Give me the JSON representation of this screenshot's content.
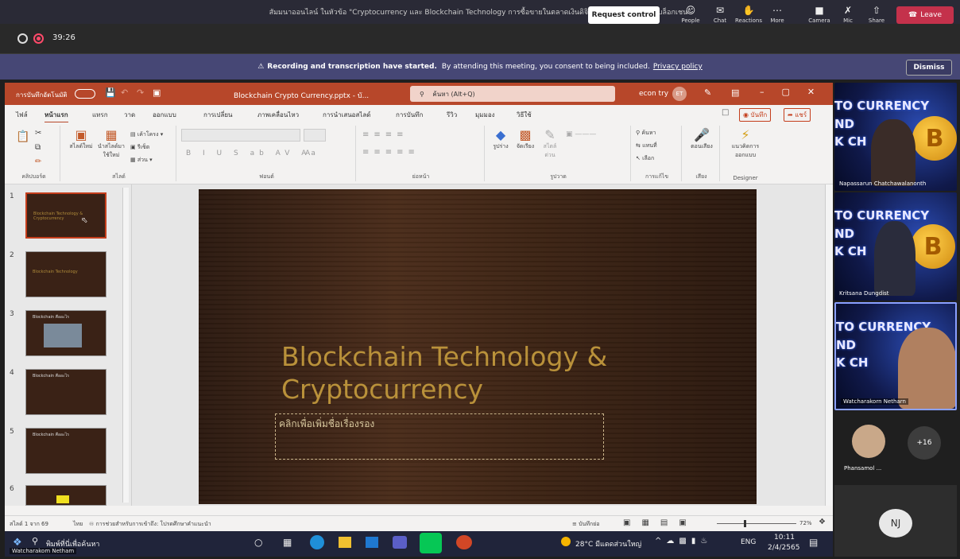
{
  "window_title": "สัมมนาออนไลน์ ในหัวข้อ \"Cryptocurrency และ Blockchain Technology การซื้อขายในตลาดเงินดิจิทัล และรู้จักเทคโนโลยีบล็อกเชน\"",
  "meeting": {
    "timer": "39:26",
    "request_control": "Request control",
    "buttons": [
      {
        "label": "People",
        "icon": "people-icon"
      },
      {
        "label": "Chat",
        "icon": "chat-icon"
      },
      {
        "label": "Reactions",
        "icon": "reactions-icon"
      },
      {
        "label": "More",
        "icon": "more-icon"
      },
      {
        "label": "Camera",
        "icon": "camera-off-icon"
      },
      {
        "label": "Mic",
        "icon": "mic-off-icon"
      },
      {
        "label": "Share",
        "icon": "share-icon"
      }
    ],
    "leave": "Leave"
  },
  "banner": {
    "bold": "Recording and transcription have started.",
    "text": "By attending this meeting, you consent to being included.",
    "link": "Privacy policy",
    "dismiss": "Dismiss"
  },
  "ppt": {
    "autosave": "การบันทึกอัตโนมัติ",
    "filename": "Blockchain Crypto Currency.pptx - บั...",
    "search": "ค้นหา (Alt+Q)",
    "user": "econ try",
    "user_initials": "ET",
    "tabs": [
      "ไฟล์",
      "หน้าแรก",
      "แทรก",
      "วาด",
      "ออกแบบ",
      "การเปลี่ยน",
      "ภาพเคลื่อนไหว",
      "การนำเสนอสไลด์",
      "การบันทึก",
      "รีวิว",
      "มุมมอง",
      "วิธีใช้"
    ],
    "record": "บันทึก",
    "share": "แชร์",
    "groups": [
      "คลิปบอร์ด",
      "สไลด์",
      "ฟอนต์",
      "ย่อหน้า",
      "รูปวาด",
      "การแก้ไข",
      "เสียง",
      "Designer"
    ],
    "ribbon_buttons": {
      "new_slide": "สไลด์ใหม่",
      "reuse_slide": "นำสไลด์มาใช้ใหม่",
      "layout": "เค้าโครง",
      "reset": "รีเซ็ต",
      "section": "ส่วน",
      "shapes": "รูปร่าง",
      "arrange": "จัดเรียง",
      "quick_styles": "สไตล์ด่วน",
      "find": "ค้นหา",
      "replace": "แทนที่",
      "select": "เลือก",
      "dictate": "ตอนเสียง",
      "designer": "แนวคิดการออกแบบ"
    },
    "slides": [
      {
        "num": "1",
        "caption": "Blockchain Technology & Cryptocurrency"
      },
      {
        "num": "2",
        "caption": "Blockchain Technology"
      },
      {
        "num": "3",
        "caption": "Blockchain คืออะไร"
      },
      {
        "num": "4",
        "caption": "Blockchain คืออะไร"
      },
      {
        "num": "5",
        "caption": "Blockchain คืออะไร"
      },
      {
        "num": "6",
        "caption": ""
      }
    ],
    "slide_title_1": "Blockchain Technology &",
    "slide_title_2": "Cryptocurrency",
    "slide_subtitle": "คลิกเพื่อเพิ่มชื่อเรื่องรอง",
    "status_slide": "สไลด์ 1 จาก 69",
    "status_lang": "ไทย",
    "status_access": "การช่วยสำหรับการเข้าถึง: โปรดศึกษาคำแนะนำ",
    "status_notes": "บันทึกย่อ",
    "zoom": "72%"
  },
  "taskbar": {
    "search": "พิมพ์ที่นี่เพื่อค้นหา",
    "presenter": "Watcharakom Netham",
    "weather": "28°C มีแดดส่วนใหญ่",
    "lang": "ENG",
    "time": "10:11",
    "date": "2/4/2565"
  },
  "participants": [
    {
      "name": "Napassarun Chatchawalanonth"
    },
    {
      "name": "Kritsana Dungdist"
    },
    {
      "name": "Watcharakorn Netharn"
    },
    {
      "name": "Phansamol ..."
    }
  ],
  "tile_text": [
    "TO CURRENCY",
    "ND",
    "K CH"
  ],
  "overflow_count": "+16",
  "self_initials": "NJ",
  "colors": {
    "ppt_accent": "#b7472a",
    "teams_banner": "#464775",
    "leave": "#c4314b"
  }
}
